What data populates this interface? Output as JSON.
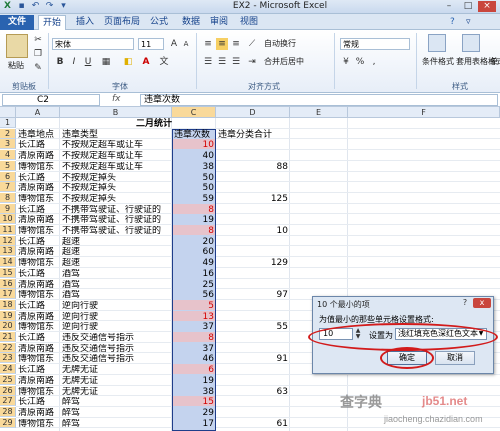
{
  "window": {
    "title": "EX2 - Microsoft Excel",
    "title_suffix_faded": "Microsoft Excel"
  },
  "tabs": [
    "文件",
    "开始",
    "插入",
    "页面布局",
    "公式",
    "数据",
    "审阅",
    "视图"
  ],
  "ribbon": {
    "paste_label": "粘贴",
    "clipboard_group": "剪贴板",
    "font_group": "字体",
    "align_group": "对齐方式",
    "font_name": "宋体",
    "font_size": "11",
    "bold": "B",
    "italic": "I",
    "underline": "U",
    "wrap_text": "自动换行",
    "merge_center": "合并后居中",
    "number_format": "常规",
    "cond_format": "条件格式",
    "table_format": "套用表格格式",
    "styles_partial": "单",
    "styles_group": "样式"
  },
  "formula_bar": {
    "name_box": "C2",
    "fx": "fx",
    "content": "违章次数"
  },
  "columns": [
    "A",
    "B",
    "C",
    "D",
    "E",
    "F"
  ],
  "sheet": {
    "title": "二月统计",
    "headers": [
      "违章地点",
      "违章类型",
      "违章次数",
      "违章分类合计"
    ],
    "rows": [
      {
        "r": "3",
        "a": "长江路",
        "b": "不按规定超车或让车",
        "c": "10",
        "d": "",
        "red": true
      },
      {
        "r": "4",
        "a": "清原南路",
        "b": "不按规定超车或让车",
        "c": "40",
        "d": "",
        "red": false
      },
      {
        "r": "5",
        "a": "博物馆东",
        "b": "不按规定超车或让车",
        "c": "38",
        "d": "88",
        "red": false
      },
      {
        "r": "6",
        "a": "长江路",
        "b": "不按规定掉头",
        "c": "50",
        "d": "",
        "red": false
      },
      {
        "r": "7",
        "a": "清原南路",
        "b": "不按规定掉头",
        "c": "50",
        "d": "",
        "red": false
      },
      {
        "r": "8",
        "a": "博物馆东",
        "b": "不按规定掉头",
        "c": "59",
        "d": "125",
        "red": false
      },
      {
        "r": "9",
        "a": "长江路",
        "b": "不携带驾驶证、行驶证的",
        "c": "8",
        "d": "",
        "red": true
      },
      {
        "r": "10",
        "a": "清原南路",
        "b": "不携带驾驶证、行驶证的",
        "c": "19",
        "d": "",
        "red": false
      },
      {
        "r": "11",
        "a": "博物馆东",
        "b": "不携带驾驶证、行驶证的",
        "c": "8",
        "d": "10",
        "red": true
      },
      {
        "r": "12",
        "a": "长江路",
        "b": "超速",
        "c": "20",
        "d": "",
        "red": false
      },
      {
        "r": "13",
        "a": "清原南路",
        "b": "超速",
        "c": "60",
        "d": "",
        "red": false
      },
      {
        "r": "14",
        "a": "博物馆东",
        "b": "超速",
        "c": "49",
        "d": "129",
        "red": false
      },
      {
        "r": "15",
        "a": "长江路",
        "b": "酒驾",
        "c": "16",
        "d": "",
        "red": false
      },
      {
        "r": "16",
        "a": "清原南路",
        "b": "酒驾",
        "c": "25",
        "d": "",
        "red": false
      },
      {
        "r": "17",
        "a": "博物馆东",
        "b": "酒驾",
        "c": "56",
        "d": "97",
        "red": false
      },
      {
        "r": "18",
        "a": "长江路",
        "b": "逆向行驶",
        "c": "5",
        "d": "",
        "red": true
      },
      {
        "r": "19",
        "a": "清原南路",
        "b": "逆向行驶",
        "c": "13",
        "d": "",
        "red": true
      },
      {
        "r": "20",
        "a": "博物馆东",
        "b": "逆向行驶",
        "c": "37",
        "d": "55",
        "red": false
      },
      {
        "r": "21",
        "a": "长江路",
        "b": "违反交通信号指示",
        "c": "8",
        "d": "",
        "red": true
      },
      {
        "r": "22",
        "a": "清原南路",
        "b": "违反交通信号指示",
        "c": "37",
        "d": "",
        "red": false
      },
      {
        "r": "23",
        "a": "博物馆东",
        "b": "违反交通信号指示",
        "c": "46",
        "d": "91",
        "red": false
      },
      {
        "r": "24",
        "a": "长江路",
        "b": "无牌无证",
        "c": "6",
        "d": "",
        "red": true
      },
      {
        "r": "25",
        "a": "清原南路",
        "b": "无牌无证",
        "c": "19",
        "d": "",
        "red": false
      },
      {
        "r": "26",
        "a": "博物馆东",
        "b": "无牌无证",
        "c": "38",
        "d": "63",
        "red": false
      },
      {
        "r": "27",
        "a": "长江路",
        "b": "醉驾",
        "c": "15",
        "d": "",
        "red": true
      },
      {
        "r": "28",
        "a": "清原南路",
        "b": "醉驾",
        "c": "29",
        "d": "",
        "red": false
      },
      {
        "r": "29",
        "a": "博物馆东",
        "b": "醉驾",
        "c": "17",
        "d": "61",
        "red": false
      }
    ]
  },
  "dialog": {
    "title": "10 个最小的项",
    "prompt": "为值最小的那些单元格设置格式:",
    "count": "10",
    "set_label": "设置为",
    "format_option": "浅红填充色深红色文本",
    "ok": "确定",
    "cancel": "取消",
    "help": "?",
    "close": "x"
  },
  "watermark": {
    "site1": "查字典",
    "site2": "jb51.net",
    "site3": "jiaocheng.chazidian.com"
  },
  "colors": {
    "selected_column_fill": "#c4d3ee",
    "highlight_fill": "#e7c3cb",
    "highlight_text": "#d40000",
    "file_tab": "#2a63b0",
    "annotation_ring": "#d21b1b"
  }
}
